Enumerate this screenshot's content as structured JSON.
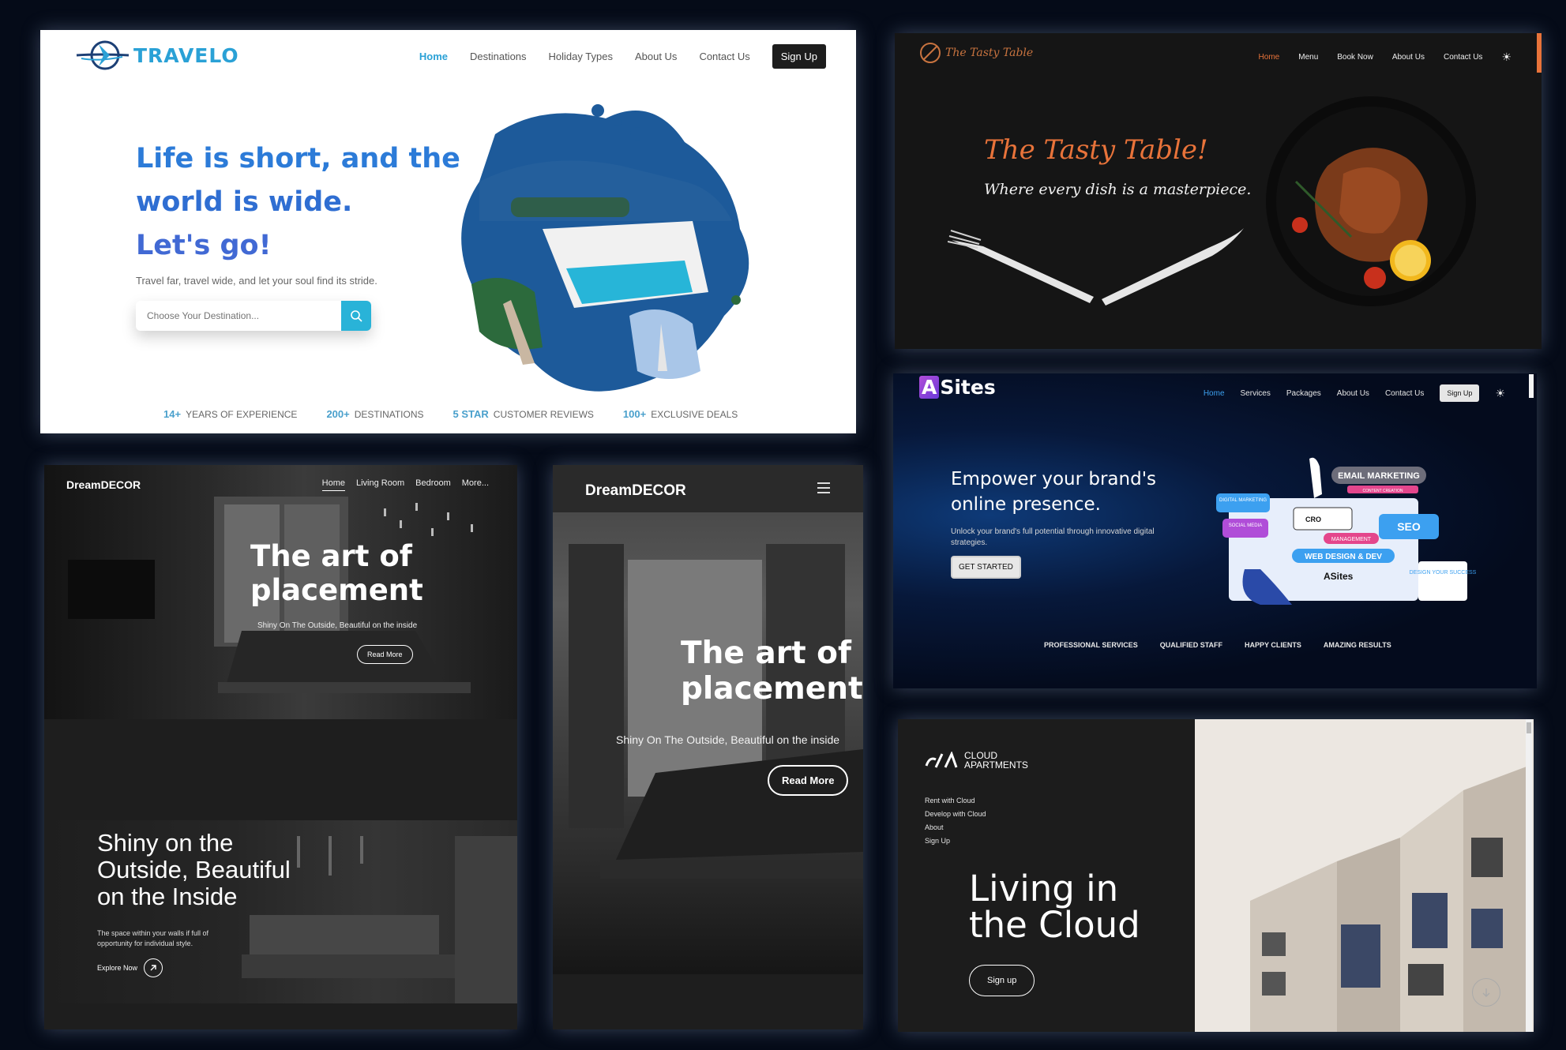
{
  "travelo": {
    "logo": "TRAVELO",
    "nav": [
      "Home",
      "Destinations",
      "Holiday Types",
      "About Us",
      "Contact Us"
    ],
    "signup": "Sign Up",
    "hero_line1": "Life is short, and the",
    "hero_line2": "world is wide.",
    "hero_line3": "Let's go!",
    "subtitle": "Travel far, travel wide, and let your soul find its stride.",
    "search_placeholder": "Choose Your Destination...",
    "stats": [
      {
        "value": "14+",
        "label": "YEARS OF EXPERIENCE"
      },
      {
        "value": "200+",
        "label": "DESTINATIONS"
      },
      {
        "value": "5 STAR",
        "label": "CUSTOMER REVIEWS"
      },
      {
        "value": "100+",
        "label": "EXCLUSIVE DEALS"
      }
    ],
    "accent": "#2aa1d6"
  },
  "tasty": {
    "logo": "The Tasty Table",
    "nav": [
      "Home",
      "Menu",
      "Book Now",
      "About Us",
      "Contact Us"
    ],
    "title": "The Tasty Table!",
    "tagline": "Where every dish is a masterpiece.",
    "accent": "#e8733a"
  },
  "asites": {
    "logo_a": "A",
    "logo_rest": "Sites",
    "nav": [
      "Home",
      "Services",
      "Packages",
      "About Us",
      "Contact Us"
    ],
    "signup": "Sign Up",
    "hero": "Empower your brand's online presence.",
    "desc": "Unlock your brand's full potential through innovative digital strategies.",
    "cta": "GET STARTED",
    "illustration": {
      "email": "EMAIL MARKETING",
      "content": "CONTENT CREATION",
      "digital": "DIGITAL MARKETING",
      "cro": "CRO",
      "social": "SOCIAL MEDIA",
      "management": "MANAGEMENT",
      "seo": "SEO",
      "web": "WEB DESIGN & DEV",
      "brand": "ASites",
      "design": "DESIGN YOUR SUCCESS"
    },
    "features": [
      "PROFESSIONAL SERVICES",
      "QUALIFIED STAFF",
      "HAPPY CLIENTS",
      "AMAZING RESULTS"
    ]
  },
  "dd1": {
    "brand": "DreamDECOR",
    "nav": [
      "Home",
      "Living Room",
      "Bedroom",
      "More..."
    ],
    "hero_title_1": "The art of",
    "hero_title_2": "placement",
    "hero_sub": "Shiny On The Outside, Beautiful on the inside",
    "hero_btn": "Read More",
    "sec_title": "Shiny on the Outside, Beautiful on the Inside",
    "sec_desc": "The space within your walls if full of opportunity for individual style.",
    "explore": "Explore Now"
  },
  "dd2": {
    "brand": "DreamDECOR",
    "title_1": "The art of",
    "title_2": "placement",
    "sub": "Shiny On The Outside, Beautiful on the inside",
    "btn": "Read More"
  },
  "cloud": {
    "logo_1": "CLOUD",
    "logo_2": "APARTMENTS",
    "menu": [
      "Rent with Cloud",
      "Develop with Cloud",
      "About",
      "Sign Up"
    ],
    "title_1": "Living in",
    "title_2": "the Cloud",
    "signup": "Sign up"
  }
}
